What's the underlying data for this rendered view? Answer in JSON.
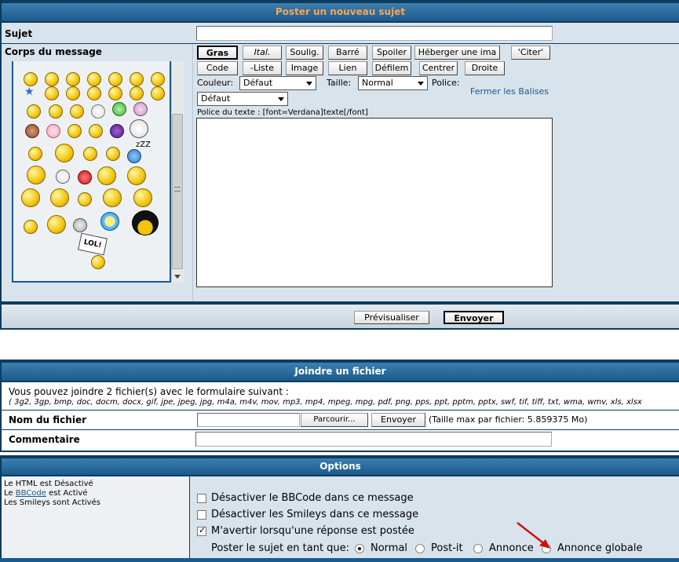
{
  "post": {
    "header": "Poster un nouveau sujet",
    "subject_label": "Sujet",
    "subject_value": "",
    "body_label": "Corps du message",
    "buttons_row1": [
      "Gras",
      "Ital.",
      "Soulig.",
      "Barré",
      "Spoiler",
      "Héberger une ima",
      "'Citer'"
    ],
    "buttons_row2": [
      "Code",
      "-Liste",
      "Image",
      "Lien",
      "Défilem",
      "Centrer",
      "Droite"
    ],
    "color_label": "Couleur:",
    "color_value": "Défaut",
    "size_label": "Taille:",
    "size_value": "Normal",
    "font_label": "Police:",
    "close_tags": "Fermer les Balises",
    "font_value": "Défaut",
    "font_hint": "Police du texte : [font=Verdana]texte[/font]",
    "message_value": "",
    "smiley_sign": "LOL!",
    "preview_button": "Prévisualiser",
    "send_button": "Envoyer"
  },
  "attach": {
    "header": "Joindre un fichier",
    "intro": "Vous pouvez joindre 2 fichier(s) avec le formulaire suivant :",
    "extensions": "( 3g2, 3gp, bmp, doc, docm, docx, gif, jpe, jpeg, jpg, m4a, m4v, mov, mp3, mp4, mpeg, mpg, pdf, png, pps, ppt, pptm, pptx, swf, tif, tiff, txt, wma, wmv, xls, xlsx",
    "file_label": "Nom du fichier",
    "file_value": "",
    "browse_button": "Parcourir...",
    "send_button": "Envoyer",
    "max_size": "(Taille max par fichier: 5.859375 Mo)",
    "comment_label": "Commentaire",
    "comment_value": ""
  },
  "options": {
    "header": "Options",
    "html_status_a": "Le HTML est Désactivé",
    "bbcode_pre": "Le",
    "bbcode_link": "BBCode",
    "bbcode_post": "est Activé",
    "smileys_status": "Les Smileys sont Activés",
    "opt_disable_bbcode": "Désactiver le BBCode dans ce message",
    "opt_disable_smileys": "Désactiver les Smileys dans ce message",
    "opt_notify": "M'avertir lorsqu'une réponse est postée",
    "post_as_label": "Poster le sujet en tant que:",
    "post_types": [
      "Normal",
      "Post-it",
      "Annonce",
      "Annonce globale"
    ],
    "selected_type": "Normal"
  },
  "colors": {
    "header_bg": "#1a5a8c",
    "header_title_orange": "#ffa34f",
    "row_bg": "#d9e3ec",
    "link": "#1a5a8c",
    "arrow": "#cc1111"
  }
}
